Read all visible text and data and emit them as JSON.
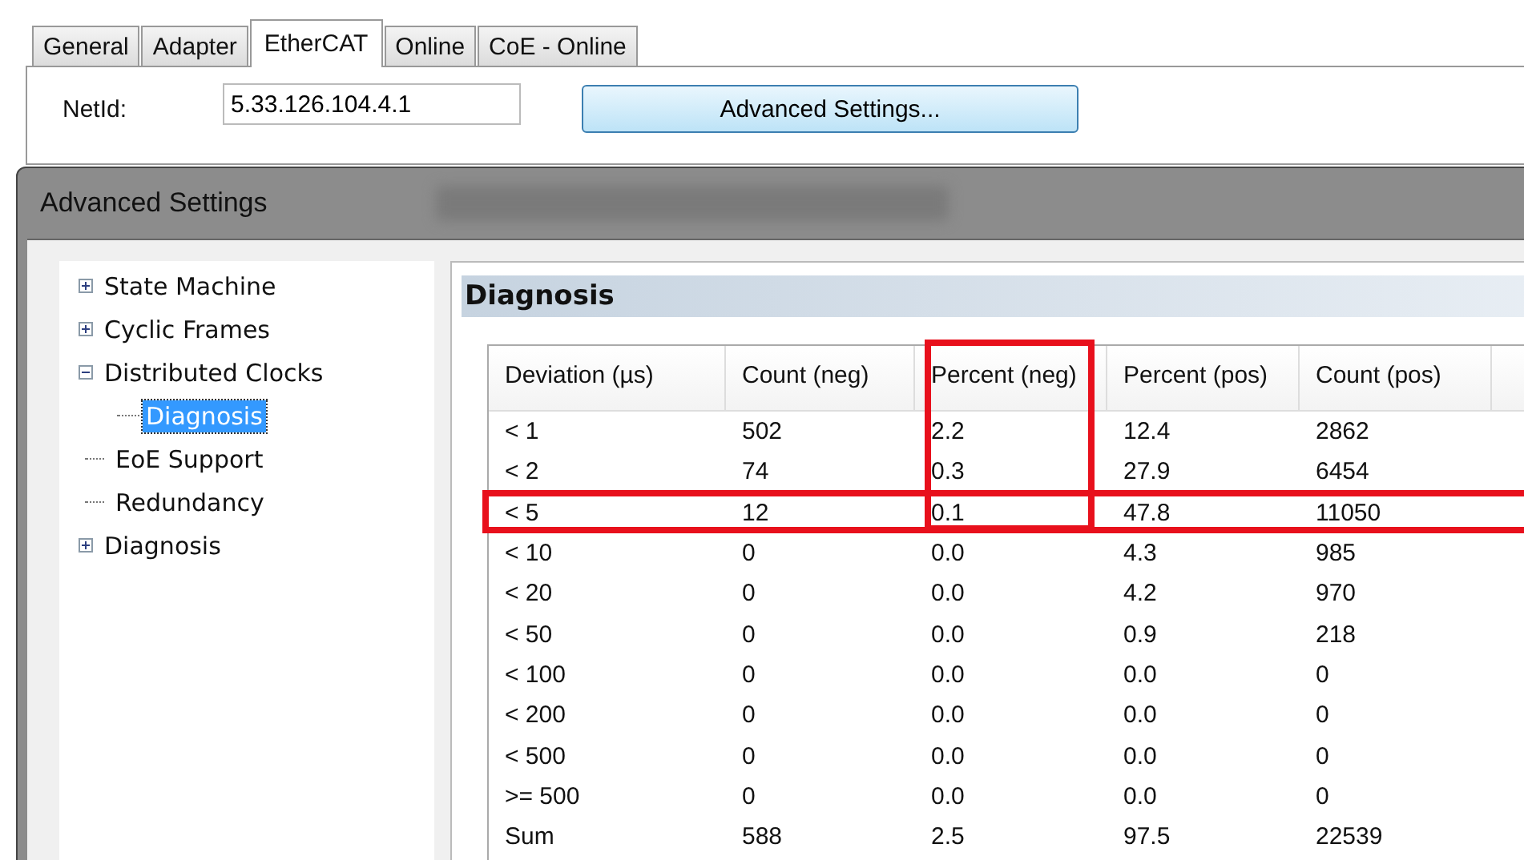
{
  "tabs": [
    {
      "label": "General",
      "selected": false
    },
    {
      "label": "Adapter",
      "selected": false
    },
    {
      "label": "EtherCAT",
      "selected": true
    },
    {
      "label": "Online",
      "selected": false
    },
    {
      "label": "CoE - Online",
      "selected": false
    }
  ],
  "netid": {
    "label": "NetId:",
    "value": "5.33.126.104.4.1"
  },
  "advanced_button": "Advanced Settings...",
  "dialog": {
    "title": "Advanced Settings",
    "tree": [
      {
        "label": "State Machine",
        "expanded": false,
        "selected": false
      },
      {
        "label": "Cyclic Frames",
        "expanded": false,
        "selected": false
      },
      {
        "label": "Distributed Clocks",
        "expanded": true,
        "selected": false,
        "children": [
          {
            "label": "Diagnosis",
            "selected": true
          }
        ]
      },
      {
        "label": "EoE Support",
        "selected": false
      },
      {
        "label": "Redundancy",
        "selected": false
      },
      {
        "label": "Diagnosis",
        "expanded": false,
        "selected": false
      }
    ],
    "panel_title": "Diagnosis",
    "table": {
      "columns": [
        {
          "label": "Deviation (µs)",
          "highlighted": false
        },
        {
          "label": "Count (neg)",
          "highlighted": false
        },
        {
          "label": "Percent (neg)",
          "highlighted": true
        },
        {
          "label": "Percent (pos)",
          "highlighted": false
        },
        {
          "label": "Count (pos)",
          "highlighted": false
        }
      ],
      "rows": [
        {
          "cells": [
            "< 1",
            "502",
            "2.2",
            "12.4",
            "2862"
          ],
          "highlighted": false
        },
        {
          "cells": [
            "< 2",
            "74",
            "0.3",
            "27.9",
            "6454"
          ],
          "highlighted": false
        },
        {
          "cells": [
            "< 5",
            "12",
            "0.1",
            "47.8",
            "11050"
          ],
          "highlighted": true
        },
        {
          "cells": [
            "< 10",
            "0",
            "0.0",
            "4.3",
            "985"
          ],
          "highlighted": false
        },
        {
          "cells": [
            "< 20",
            "0",
            "0.0",
            "4.2",
            "970"
          ],
          "highlighted": false
        },
        {
          "cells": [
            "< 50",
            "0",
            "0.0",
            "0.9",
            "218"
          ],
          "highlighted": false
        },
        {
          "cells": [
            "< 100",
            "0",
            "0.0",
            "0.0",
            "0"
          ],
          "highlighted": false
        },
        {
          "cells": [
            "< 200",
            "0",
            "0.0",
            "0.0",
            "0"
          ],
          "highlighted": false
        },
        {
          "cells": [
            "< 500",
            "0",
            "0.0",
            "0.0",
            "0"
          ],
          "highlighted": false
        },
        {
          "cells": [
            ">= 500",
            "0",
            "0.0",
            "0.0",
            "0"
          ],
          "highlighted": false
        },
        {
          "cells": [
            "Sum",
            "588",
            "2.5",
            "97.5",
            "22539"
          ],
          "highlighted": false
        }
      ]
    }
  }
}
